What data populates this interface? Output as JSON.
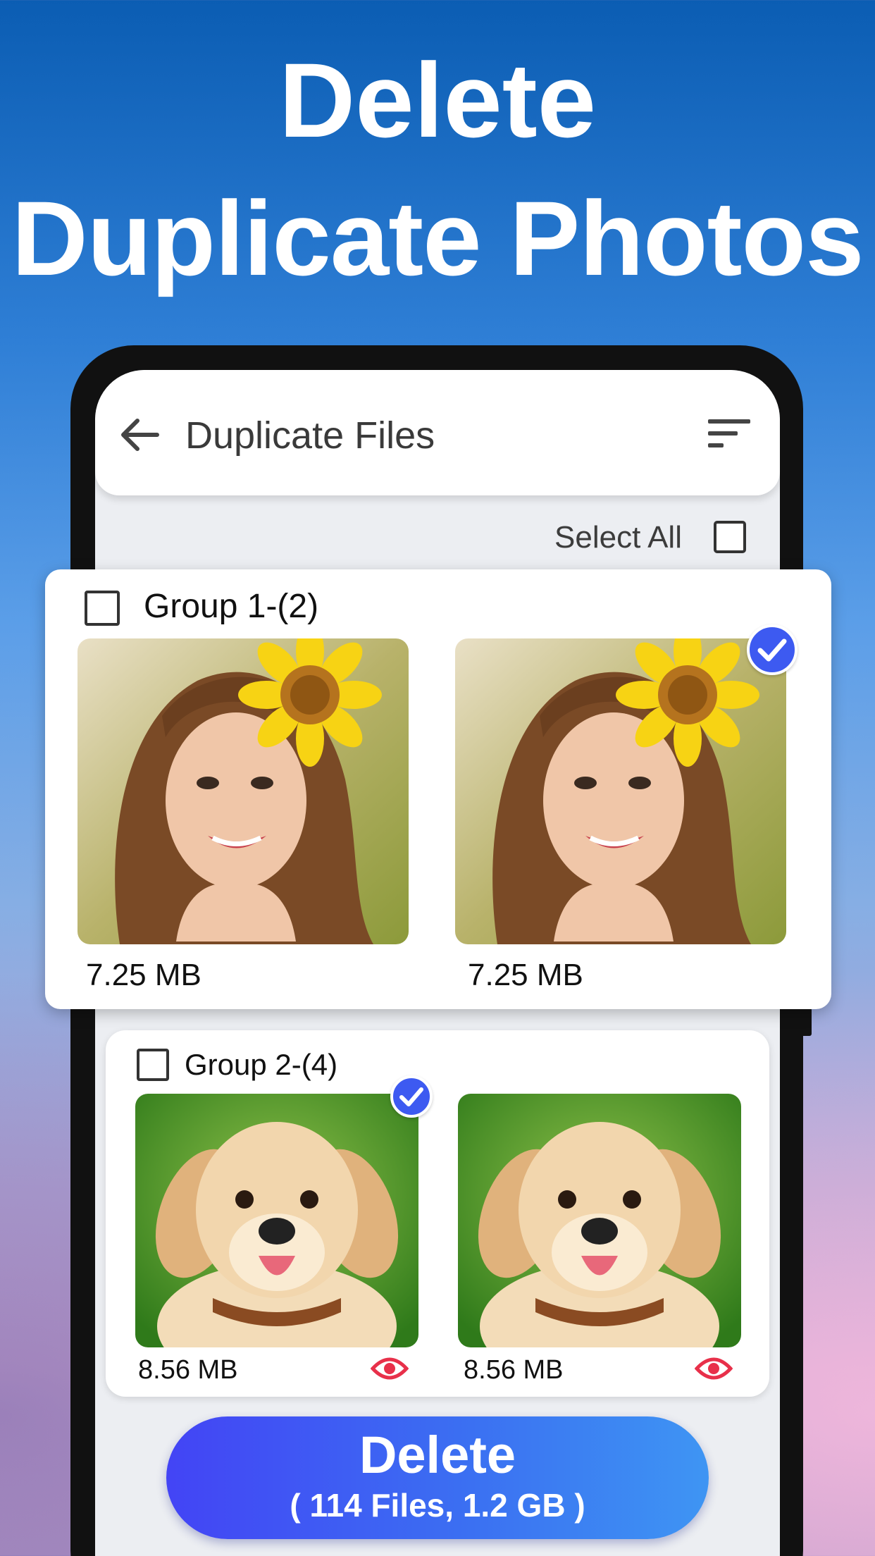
{
  "promo": {
    "line1": "Delete",
    "line2": "Duplicate Photos"
  },
  "appbar": {
    "title": "Duplicate Files",
    "back_icon": "arrow-left-icon",
    "sort_icon": "sort-icon"
  },
  "select_all": {
    "label": "Select All",
    "checked": false
  },
  "groups": [
    {
      "title": "Group 1-(2)",
      "checked": false,
      "items": [
        {
          "size": "7.25 MB",
          "image": "woman-with-sunflower-photo",
          "selected": false
        },
        {
          "size": "7.25 MB",
          "image": "woman-with-sunflower-photo",
          "selected": true
        }
      ]
    },
    {
      "title": "Group 2-(4)",
      "checked": false,
      "items": [
        {
          "size": "8.56 MB",
          "image": "golden-retriever-puppy-photo",
          "selected": true,
          "icon": "eye-icon"
        },
        {
          "size": "8.56 MB",
          "image": "golden-retriever-puppy-photo",
          "selected": false,
          "icon": "eye-icon"
        }
      ]
    }
  ],
  "delete_button": {
    "label": "Delete",
    "summary": "( 114 Files, 1.2 GB )"
  },
  "colors": {
    "accent": "#3d5af1",
    "eye": "#e8304a",
    "button_start": "#4344f5",
    "button_end": "#3e95f3"
  }
}
